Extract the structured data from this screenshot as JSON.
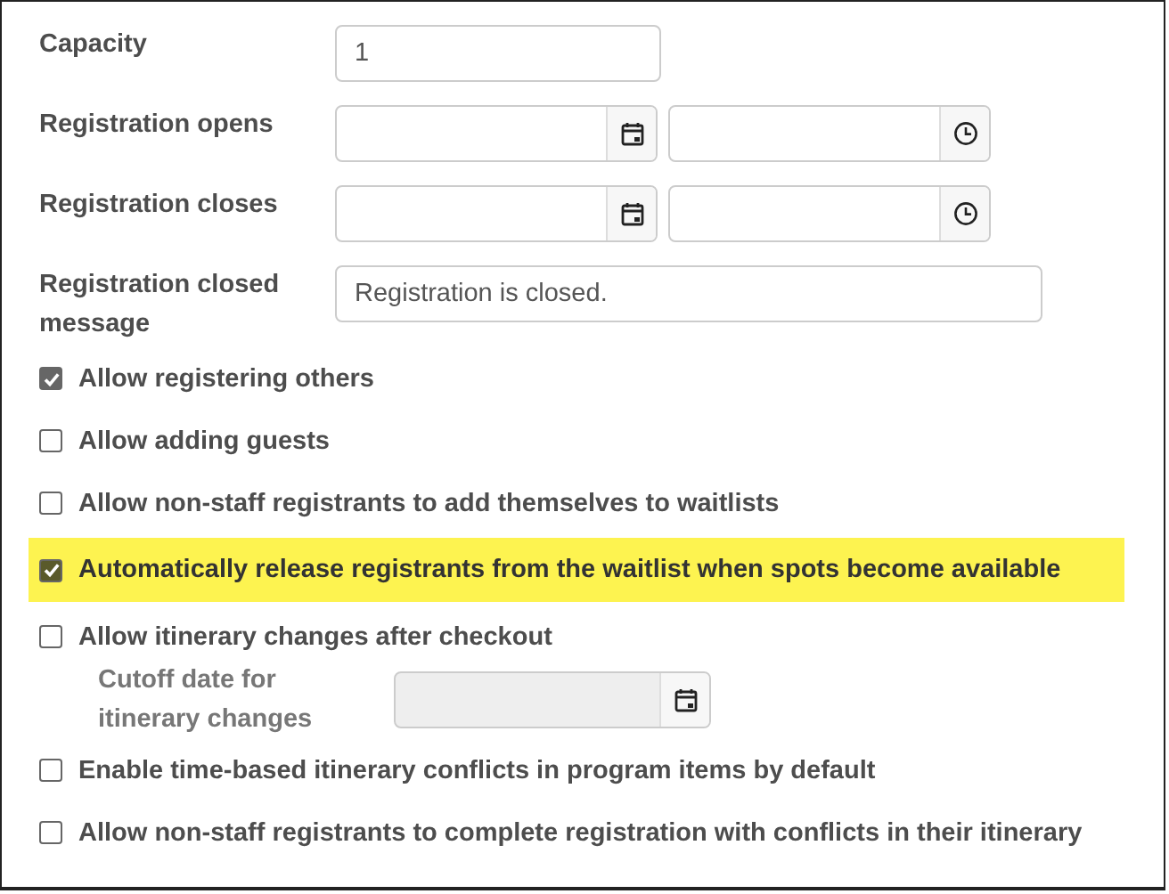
{
  "fields": [
    {
      "kind": "text",
      "label": "Capacity",
      "value": "1"
    },
    {
      "kind": "datetime",
      "label": "Registration opens"
    },
    {
      "kind": "datetime",
      "label": "Registration closes"
    },
    {
      "kind": "wide_text",
      "label": "Registration closed message",
      "value": "Registration is closed."
    }
  ],
  "options": [
    {
      "label": "Allow registering others",
      "checked": true,
      "highlighted": false
    },
    {
      "label": "Allow adding guests",
      "checked": false,
      "highlighted": false
    },
    {
      "label": "Allow non-staff registrants to add themselves to waitlists",
      "checked": false,
      "highlighted": false
    },
    {
      "label": "Automatically release registrants from the waitlist when spots become available",
      "checked": true,
      "highlighted": true
    },
    {
      "label": "Allow itinerary changes after checkout",
      "checked": false,
      "highlighted": false,
      "subfield": {
        "label": "Cutoff date for itinerary changes",
        "disabled": true
      }
    },
    {
      "label": "Enable time-based itinerary conflicts in program items by default",
      "checked": false,
      "highlighted": false
    },
    {
      "label": "Allow non-staff registrants to complete registration with conflicts in their itinerary",
      "checked": false,
      "highlighted": false
    }
  ]
}
